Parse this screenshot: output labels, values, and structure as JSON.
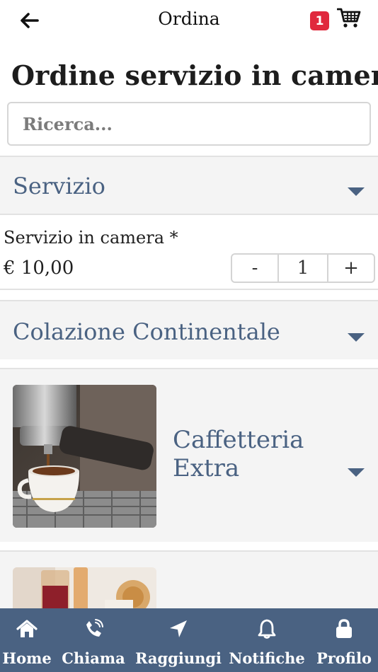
{
  "header": {
    "title": "Ordina",
    "cart_count": "1",
    "back_icon": "arrow-left-icon",
    "cart_icon": "shopping-cart-icon"
  },
  "page": {
    "title": "Ordine servizio in camera"
  },
  "search": {
    "placeholder": "Ricerca..."
  },
  "sections": [
    {
      "title": "Servizio",
      "items": [
        {
          "name": "Servizio in camera *",
          "price": "€ 10,00",
          "quantity": "1",
          "minus_label": "-",
          "plus_label": "+"
        }
      ]
    },
    {
      "title": "Colazione Continentale"
    }
  ],
  "categories": [
    {
      "title": "Caffetteria Extra",
      "image": "espresso-machine-photo"
    },
    {
      "title": "",
      "image": "juice-glasses-photo"
    }
  ],
  "bottom_nav": [
    {
      "label": "Home",
      "icon": "home-icon"
    },
    {
      "label": "Chiama",
      "icon": "phone-icon"
    },
    {
      "label": "Raggiungi",
      "icon": "location-arrow-icon"
    },
    {
      "label": "Notifiche",
      "icon": "bell-icon"
    },
    {
      "label": "Profilo",
      "icon": "lock-icon"
    }
  ],
  "colors": {
    "accent": "#4a6282",
    "badge": "#e0283d",
    "section_bg": "#f4f4f4"
  }
}
